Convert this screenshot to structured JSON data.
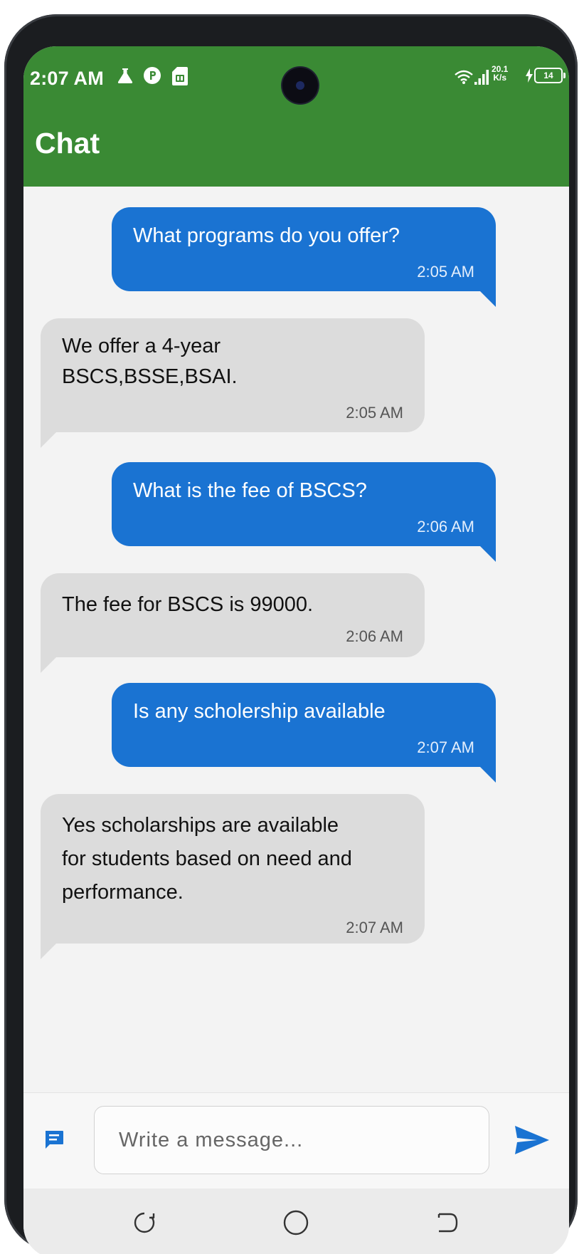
{
  "status_bar": {
    "time": "2:07 AM",
    "icons": [
      "flask-icon",
      "p-circle-icon",
      "sim-card-icon",
      "wifi-icon",
      "signal-icon",
      "charging-icon"
    ],
    "network_speed_value": "20.1",
    "network_speed_unit": "K/s",
    "battery_level": "14"
  },
  "app_bar": {
    "title": "Chat",
    "color": "#3a8a34"
  },
  "messages": [
    {
      "sender": "user",
      "lines": [
        "What programs do you offer?"
      ],
      "time": "2:05 AM"
    },
    {
      "sender": "bot",
      "lines": [
        "We offer a 4-year",
        "BSCS,BSSE,BSAI."
      ],
      "time": "2:05 AM"
    },
    {
      "sender": "user",
      "lines": [
        "What is the fee of BSCS?"
      ],
      "time": "2:06 AM"
    },
    {
      "sender": "bot",
      "lines": [
        "The fee for BSCS is 99000."
      ],
      "time": "2:06 AM"
    },
    {
      "sender": "user",
      "lines": [
        "Is any scholership available"
      ],
      "time": "2:07 AM"
    },
    {
      "sender": "bot",
      "lines": [
        "Yes scholarships are available",
        "for students based on need and",
        "performance."
      ],
      "time": "2:07 AM"
    }
  ],
  "composer": {
    "placeholder": "Write a message...",
    "value": ""
  },
  "colors": {
    "sent_bubble": "#1a73d2",
    "received_bubble": "#dcdcdc",
    "send_icon": "#1a73d2"
  },
  "nav_bar": {
    "buttons": [
      "recents-icon",
      "home-icon",
      "back-icon"
    ]
  }
}
